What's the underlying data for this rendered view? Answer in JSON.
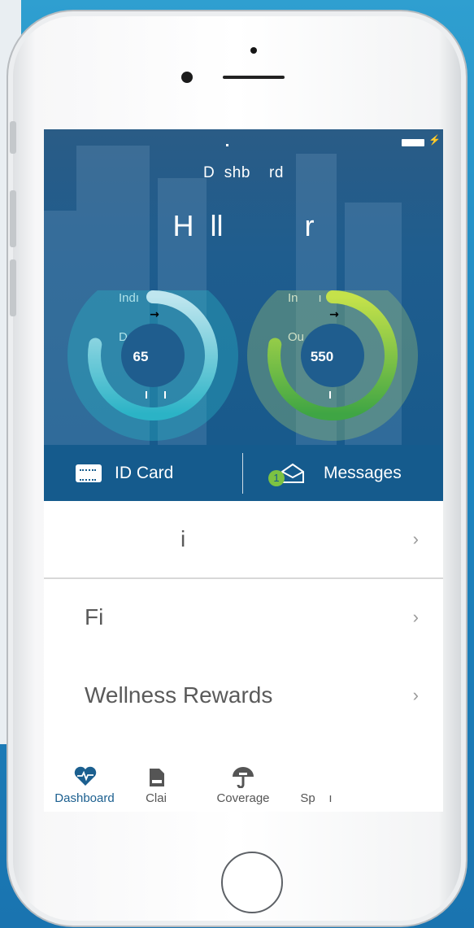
{
  "app": {
    "screen_title": "D  shb    rd",
    "greeting": "H  ll          r"
  },
  "rings": [
    {
      "label_line1": "Indı        l",
      "label_line2": "Deductı  le",
      "value": "65",
      "fraction": 0.78,
      "color_start": "#bfe6ef",
      "color_end": "#2bb3c6",
      "arrow": "→"
    },
    {
      "label_line1": "In      ı       l",
      "label_line2": "Ou      -",
      "value": "550",
      "fraction": 0.78,
      "color_start": "#c5e24a",
      "color_end": "#3fa544",
      "arrow": "→"
    }
  ],
  "actions": {
    "id_card": {
      "label": "ID Card",
      "icon": "id-card-icon"
    },
    "messages": {
      "label": "Messages",
      "icon": "envelope-open-icon",
      "badge": "1"
    }
  },
  "list": [
    {
      "label": "i",
      "chevron": "›"
    },
    {
      "label": "Fi",
      "chevron": "›"
    },
    {
      "label": "Wellness Rewards",
      "chevron": "›"
    }
  ],
  "tabs": [
    {
      "label": "Dashboard",
      "icon": "heart-pulse-icon",
      "active": true
    },
    {
      "label": "Clai",
      "icon": "document-icon",
      "active": false
    },
    {
      "label": "Coverage",
      "icon": "umbrella-icon",
      "active": false
    },
    {
      "label": "Sp    ı",
      "icon": "",
      "active": false
    }
  ],
  "colors": {
    "hero": "#1f5d8e",
    "action_bar": "#155b8d",
    "badge": "#7cc242",
    "tab_active": "#1b5f8f"
  }
}
